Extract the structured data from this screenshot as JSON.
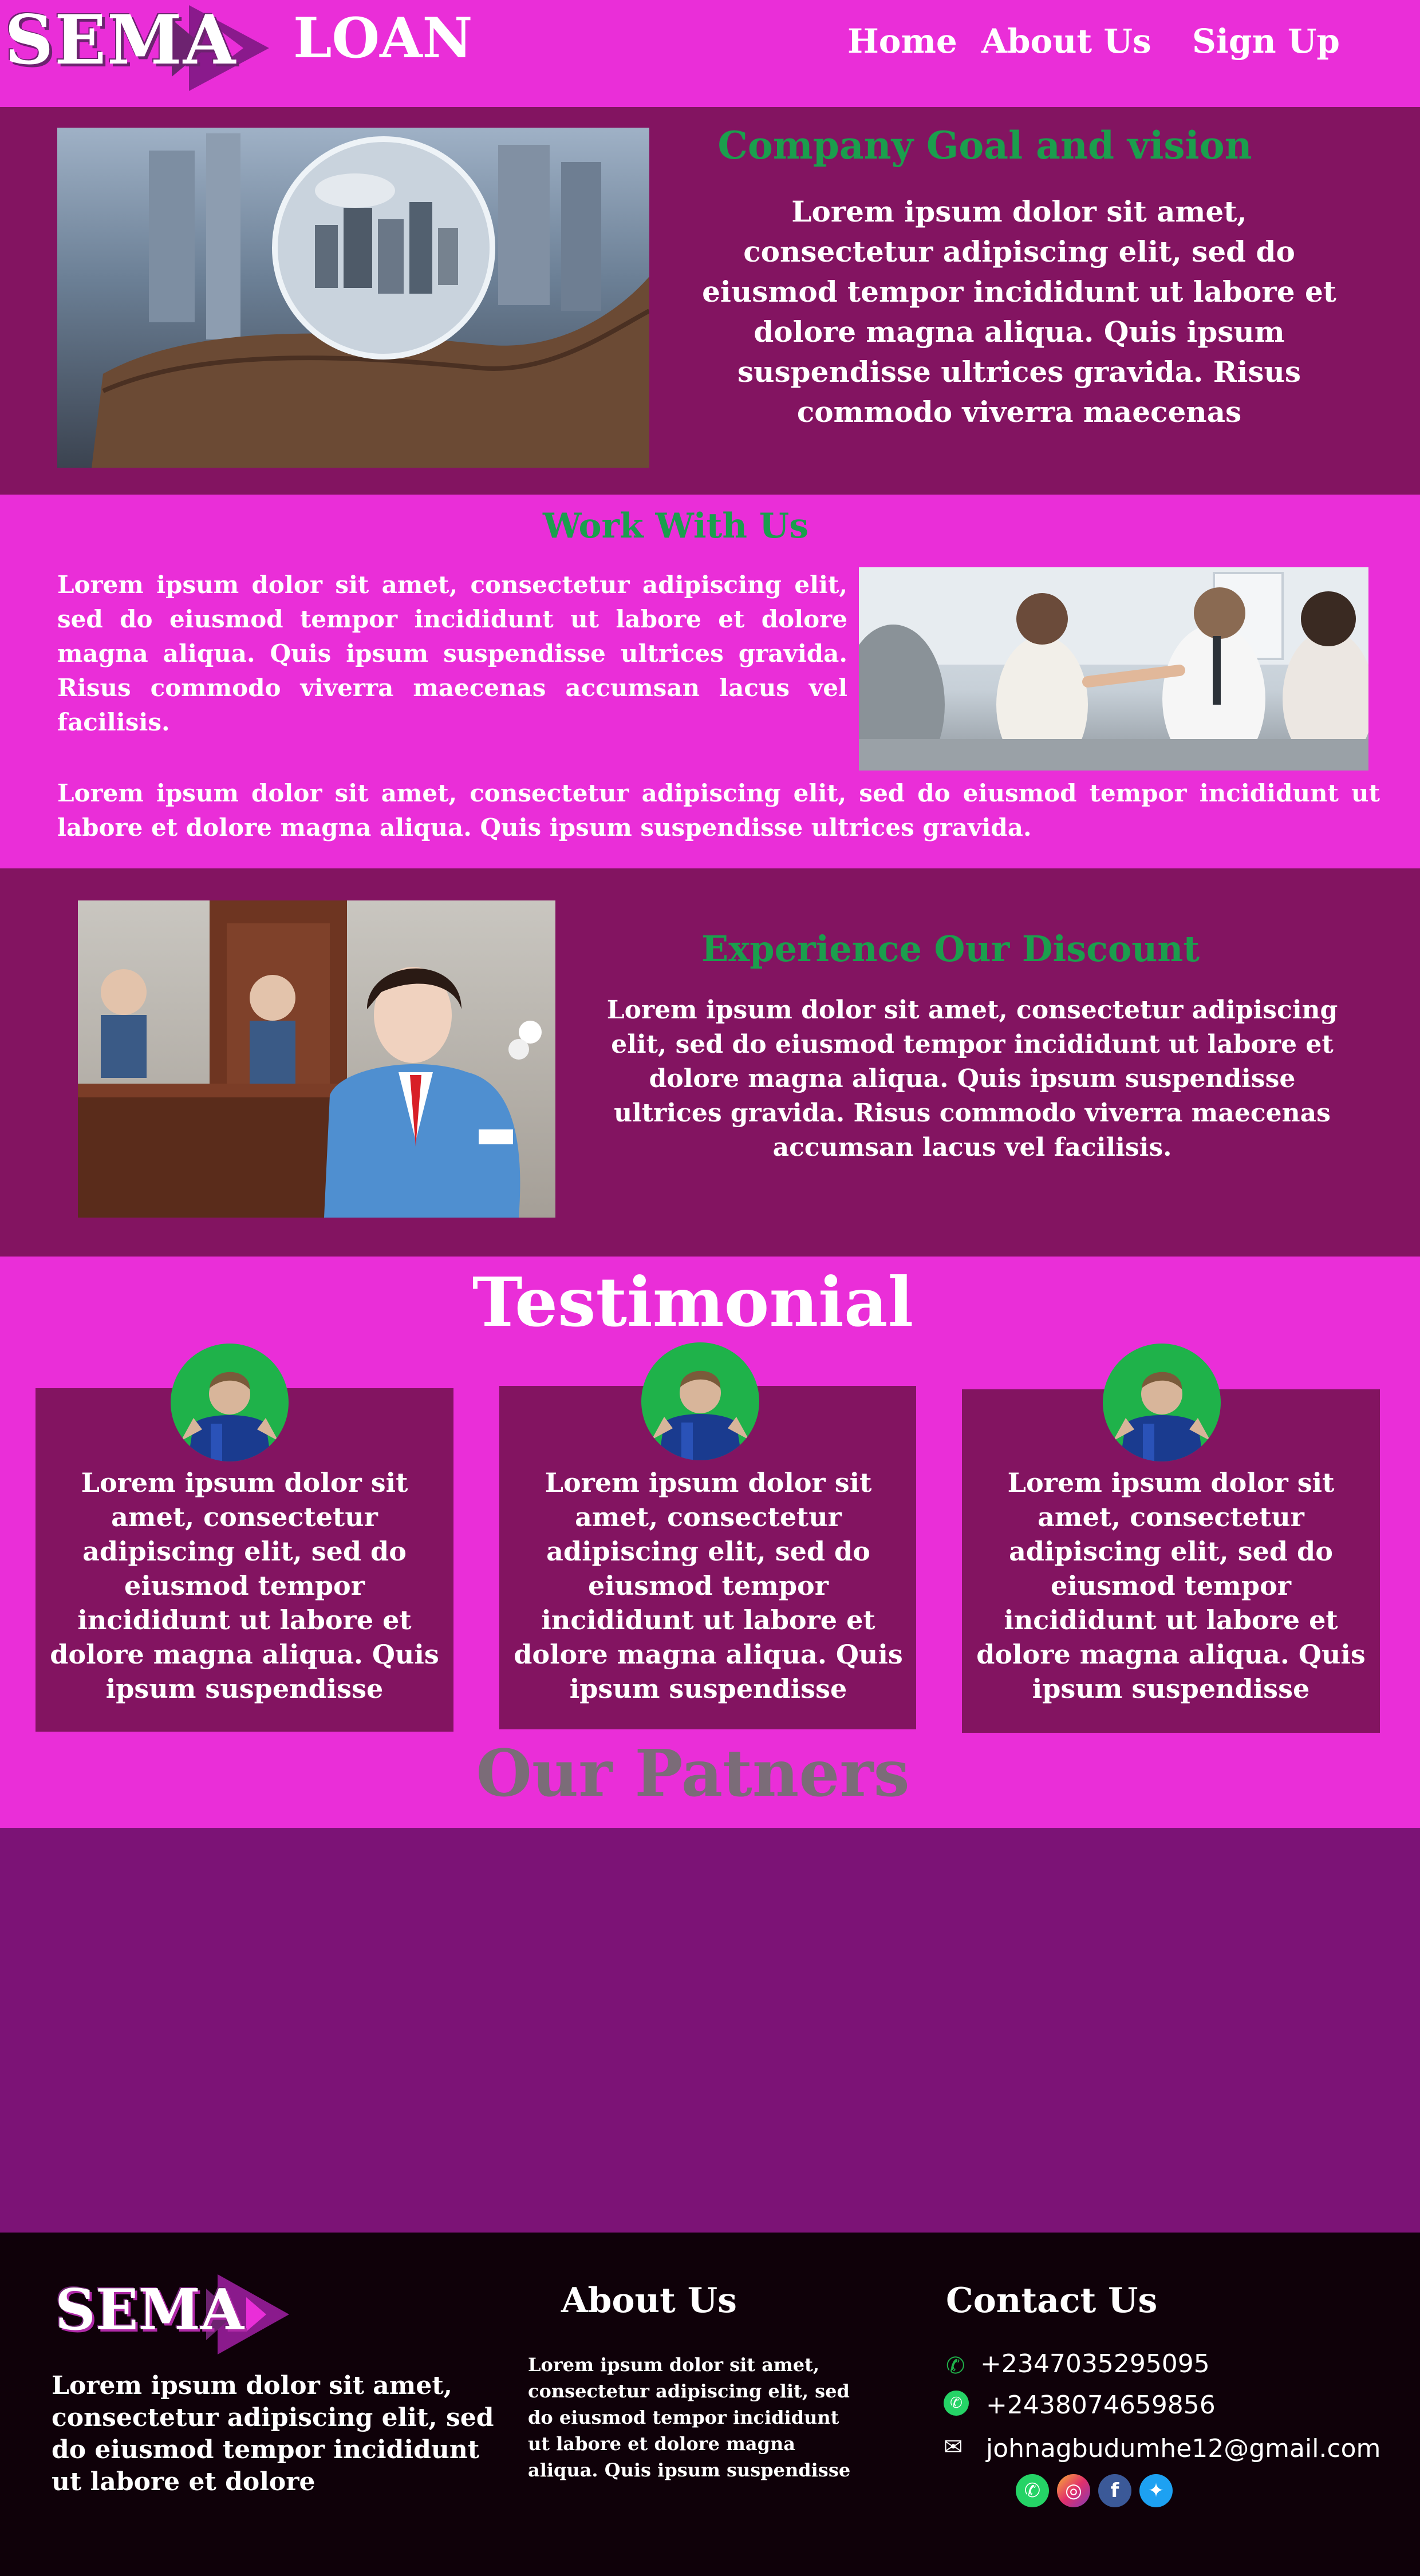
{
  "header": {
    "logo_text": "SEMA",
    "brand": "LOAN",
    "nav": [
      "Home",
      "About Us",
      "Sign Up"
    ]
  },
  "goal": {
    "title": "Company Goal and vision",
    "text": "Lorem ipsum dolor sit amet, consectetur adipiscing elit, sed do eiusmod tempor incididunt ut labore et dolore magna aliqua. Quis ipsum suspendisse ultrices gravida. Risus commodo viverra maecenas"
  },
  "work": {
    "title": "Work With Us",
    "text1": "Lorem ipsum dolor sit amet, consectetur adipiscing elit, sed do eiusmod tempor incididunt ut labore et dolore magna aliqua. Quis ipsum suspendisse ultrices gravida. Risus commodo viverra maecenas accumsan lacus vel facilisis.",
    "text2": "Lorem ipsum dolor sit amet, consectetur adipiscing elit, sed do eiusmod tempor incididunt ut labore et dolore magna aliqua. Quis ipsum suspendisse ultrices gravida."
  },
  "discount": {
    "title": "Experience Our Discount",
    "text": "Lorem ipsum dolor sit amet, consectetur adipiscing elit, sed do eiusmod tempor incididunt ut labore et dolore magna aliqua. Quis ipsum suspendisse ultrices gravida. Risus commodo viverra maecenas accumsan lacus vel facilisis."
  },
  "testimonial": {
    "title": "Testimonial",
    "cards": [
      {
        "text": "Lorem ipsum dolor sit amet, consectetur adipiscing elit, sed do eiusmod tempor incididunt ut labore et dolore magna aliqua. Quis ipsum suspendisse"
      },
      {
        "text": "Lorem ipsum dolor sit amet, consectetur adipiscing elit, sed do eiusmod tempor incididunt ut labore et dolore magna aliqua. Quis ipsum suspendisse"
      },
      {
        "text": "Lorem ipsum dolor sit amet, consectetur adipiscing elit, sed do eiusmod tempor incididunt ut labore et dolore magna aliqua. Quis ipsum suspendisse"
      }
    ]
  },
  "partners": {
    "title": "Our Patners"
  },
  "footer": {
    "logo_text": "SEMA",
    "about_text": "Lorem ipsum dolor sit amet, consectetur adipiscing elit, sed do eiusmod tempor incididunt ut labore et dolore",
    "about_title": "About Us",
    "about_small": "Lorem ipsum dolor sit amet, consectetur adipiscing elit, sed do eiusmod tempor incididunt ut labore et dolore magna aliqua. Quis ipsum suspendisse",
    "contact_title": "Contact Us",
    "phone1": "+2347035295095",
    "phone2": "+2438074659856",
    "email": "johnagbudumhe12@gmail.com",
    "social_icons": [
      "whatsapp-icon",
      "instagram-icon",
      "facebook-icon",
      "twitter-icon"
    ]
  },
  "colors": {
    "pink": "#ea2ed8",
    "dark_magenta": "#831461",
    "purple": "#7c1376",
    "green": "#1b9e4d",
    "footer_bg": "#0f0109"
  }
}
